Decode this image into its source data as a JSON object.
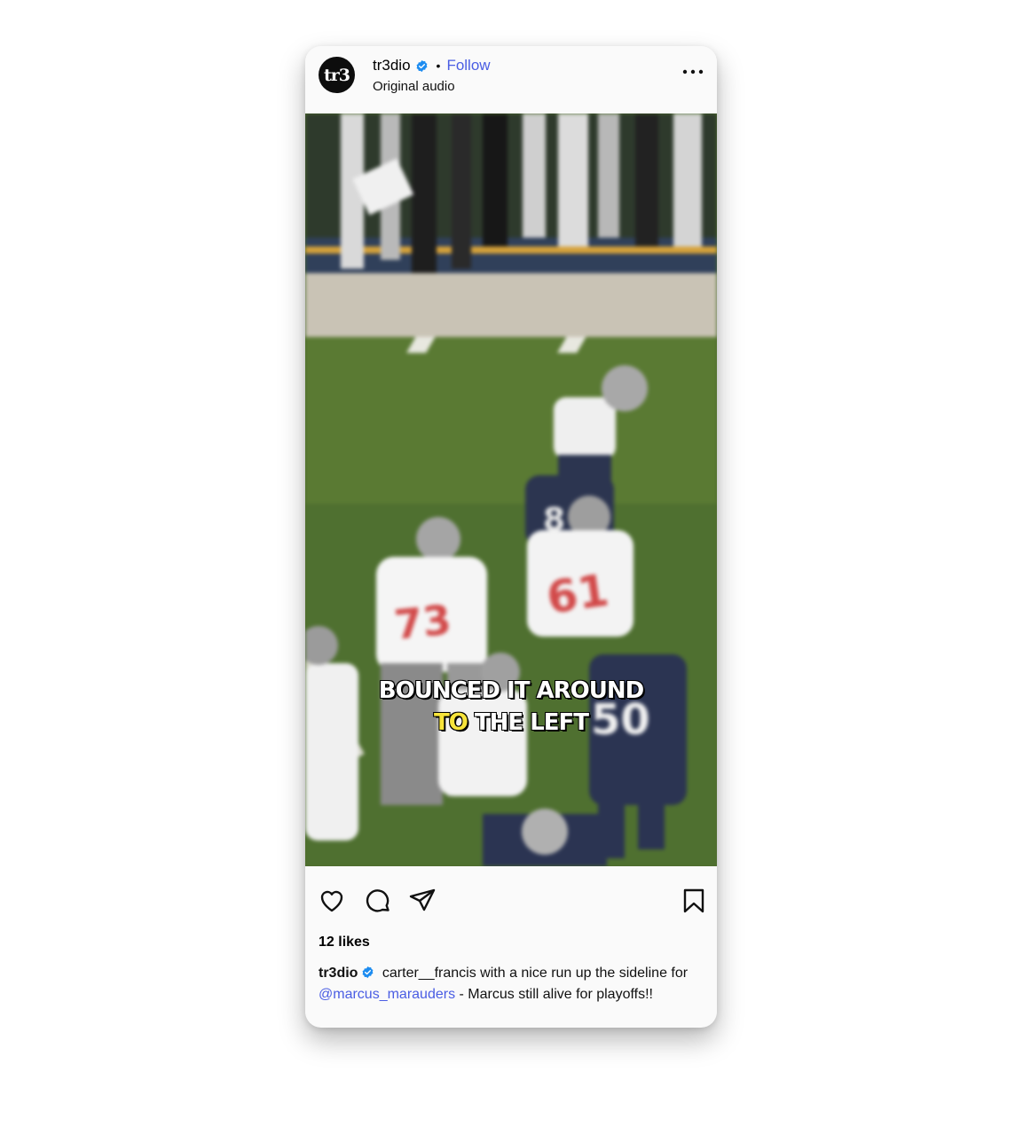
{
  "post": {
    "username": "tr3dio",
    "avatar_text": "tr3",
    "follow_label": "Follow",
    "separator": "•",
    "audio": "Original audio"
  },
  "video": {
    "caption_line1": "BOUNCED IT AROUND",
    "caption_line2_highlight": "TO",
    "caption_line2_rest": " THE LEFT",
    "jersey_numbers": [
      "73",
      "61",
      "50",
      "8"
    ]
  },
  "engagement": {
    "likes": "12 likes"
  },
  "caption": {
    "username": "tr3dio",
    "text_before_mention": " carter__francis with a nice run up the sideline for ",
    "mention": "@marcus_marauders",
    "text_after_mention": " - Marcus still alive for playoffs!!"
  },
  "colors": {
    "link": "#4a5de3",
    "verified": "#1d8cf0",
    "caption_highlight": "#f7e43a"
  },
  "icons": [
    "verified-badge-icon",
    "more-options-icon",
    "volume-icon",
    "heart-icon",
    "comment-icon",
    "share-icon",
    "bookmark-icon"
  ]
}
